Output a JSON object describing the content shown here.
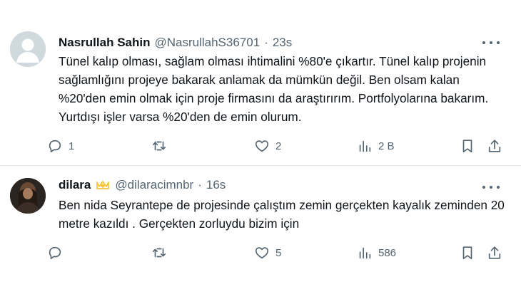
{
  "tweets": [
    {
      "name": "Nasrullah Sahin",
      "handle": "@NasrullahS36701",
      "dot": "·",
      "time": "23s",
      "text": "Tünel kalıp olması, sağlam olması ihtimalini %80'e çıkartır. Tünel kalıp projenin sağlamlığını projeye bakarak anlamak da mümkün değil. Ben olsam kalan %20'den emin olmak için proje firmasını da araştırırım. Portfolyolarına bakarım. Yurtdışı işler varsa %20'den de emin olurum.",
      "replies": "1",
      "retweets": "",
      "likes": "2",
      "views": "2 B",
      "avatar_icon": "default-avatar-icon"
    },
    {
      "name": "dilara",
      "handle": "@dilaracimnbr",
      "dot": "·",
      "time": "16s",
      "text": "Ben nida Seyrantepe de projesinde çalıştım zemin gerçekten kayalık zeminden 20 metre kazıldı . Gerçekten zorluydu  bizim için",
      "replies": "",
      "retweets": "",
      "likes": "5",
      "views": "586",
      "avatar_icon": "user-photo-avatar",
      "badge_icon": "crown-heart-badge-icon",
      "badge_color": "#f4c63d"
    }
  ],
  "icons": {
    "reply": "reply-icon",
    "retweet": "retweet-icon",
    "like": "heart-icon",
    "views": "views-chart-icon",
    "bookmark": "bookmark-icon",
    "share": "share-icon",
    "more": "more-dots-icon"
  },
  "colors": {
    "text": "#0f1419",
    "secondary": "#536471",
    "divider": "#e3e6e8",
    "avatar_placeholder": "#cfd9de"
  }
}
